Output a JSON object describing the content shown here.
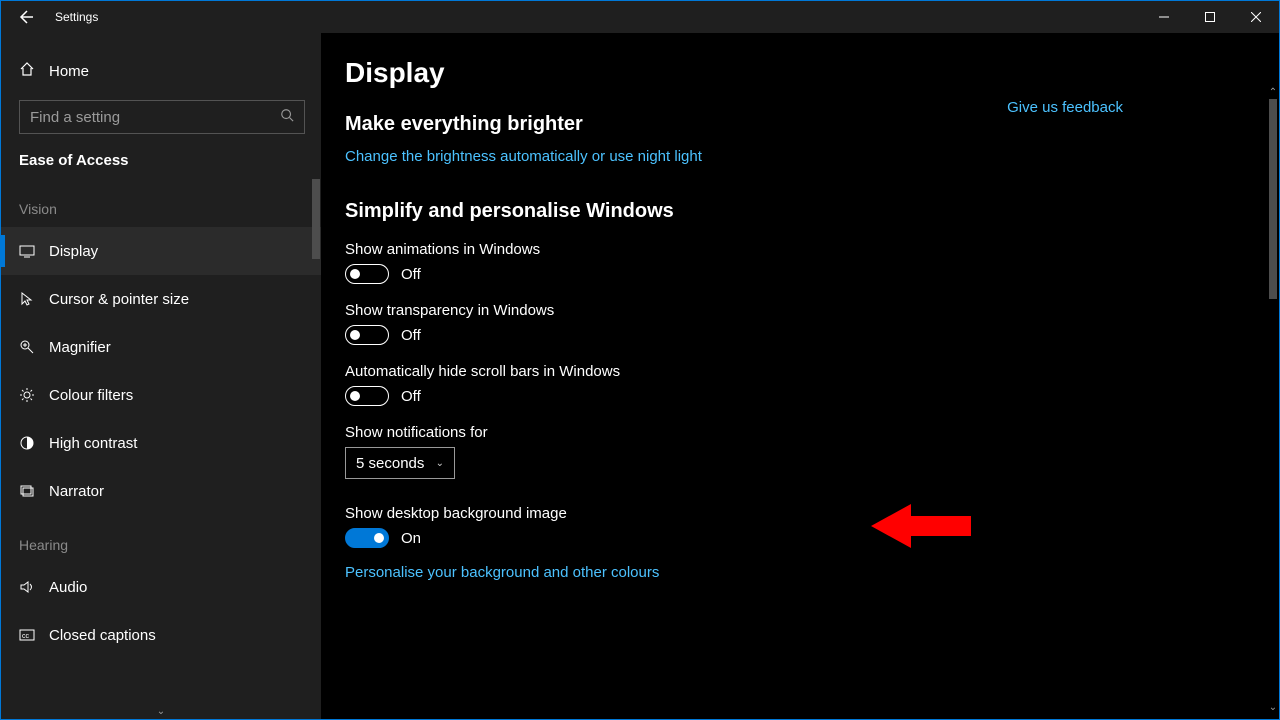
{
  "window": {
    "title": "Settings"
  },
  "sidebar": {
    "home": "Home",
    "search_placeholder": "Find a setting",
    "category": "Ease of Access",
    "groups": [
      {
        "title": "Vision",
        "items": [
          {
            "id": "display",
            "label": "Display",
            "selected": true
          },
          {
            "id": "cursor",
            "label": "Cursor & pointer size",
            "selected": false
          },
          {
            "id": "magnifier",
            "label": "Magnifier",
            "selected": false
          },
          {
            "id": "colour",
            "label": "Colour filters",
            "selected": false
          },
          {
            "id": "contrast",
            "label": "High contrast",
            "selected": false
          },
          {
            "id": "narrator",
            "label": "Narrator",
            "selected": false
          }
        ]
      },
      {
        "title": "Hearing",
        "items": [
          {
            "id": "audio",
            "label": "Audio",
            "selected": false
          },
          {
            "id": "captions",
            "label": "Closed captions",
            "selected": false
          }
        ]
      }
    ]
  },
  "content": {
    "page_title": "Display",
    "feedback": "Give us feedback",
    "sections": {
      "brightness": {
        "heading": "Make everything brighter",
        "link": "Change the brightness automatically or use night light"
      },
      "simplify": {
        "heading": "Simplify and personalise Windows",
        "animations": {
          "label": "Show animations in Windows",
          "state": "Off",
          "on": false
        },
        "transparency": {
          "label": "Show transparency in Windows",
          "state": "Off",
          "on": false
        },
        "scrollbars": {
          "label": "Automatically hide scroll bars in Windows",
          "state": "Off",
          "on": false
        },
        "notifications": {
          "label": "Show notifications for",
          "value": "5 seconds"
        },
        "desktop_bg": {
          "label": "Show desktop background image",
          "state": "On",
          "on": true
        },
        "personalise_link": "Personalise your background and other colours"
      }
    }
  }
}
